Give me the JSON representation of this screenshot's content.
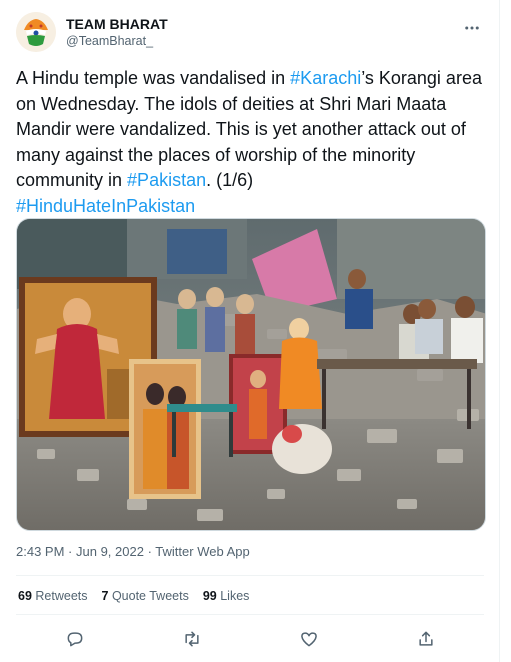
{
  "author": {
    "display_name": "TEAM BHARAT",
    "handle": "@TeamBharat_"
  },
  "tweet": {
    "text_1": "A Hindu temple was vandalised in ",
    "hashtag_1": "#Karachi",
    "text_2": "’s Korangi area on Wednesday. The idols of deities at Shri Mari Maata Mandir were vandalized. This is yet another attack out of many against the places of worship of the minority community in ",
    "hashtag_2": "#Pakistan",
    "text_3": ". (1/6)",
    "hashtag_3": "#HinduHateInPakistan"
  },
  "meta": {
    "time": "2:43 PM",
    "date": "Jun 9, 2022",
    "source": "Twitter Web App"
  },
  "stats": {
    "retweets_count": "69",
    "retweets_label": "Retweets",
    "quotes_count": "7",
    "quotes_label": "Quote Tweets",
    "likes_count": "99",
    "likes_label": "Likes"
  },
  "icons": {
    "more": "more-horizontal-icon",
    "reply": "reply-icon",
    "retweet": "retweet-icon",
    "like": "heart-icon",
    "share": "share-icon"
  },
  "colors": {
    "link": "#1d9bf0",
    "secondary_text": "#536471",
    "divider": "#eff3f4"
  }
}
